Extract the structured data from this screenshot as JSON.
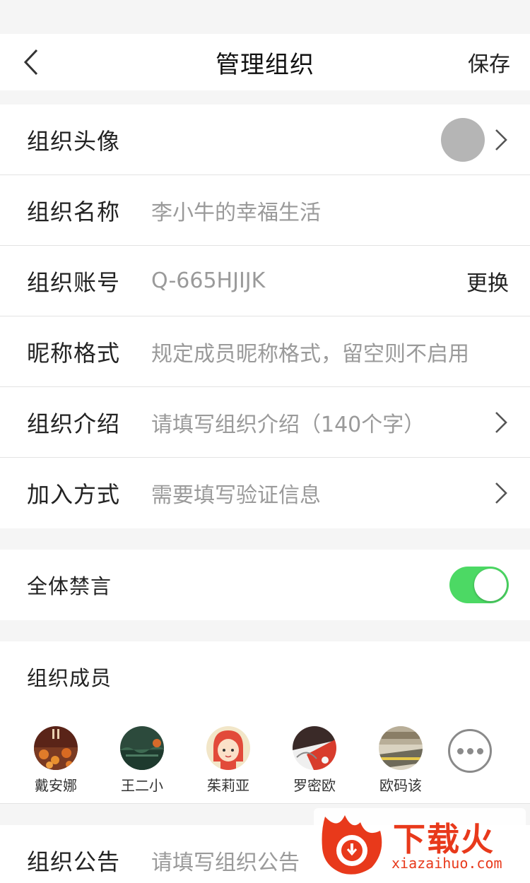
{
  "nav": {
    "title": "管理组织",
    "save_label": "保存"
  },
  "org_info": {
    "avatar_label": "组织头像",
    "name_label": "组织名称",
    "name_value": "李小牛的幸福生活",
    "account_label": "组织账号",
    "account_value": "Q-665HJIJK",
    "account_action": "更换",
    "nickname_label": "昵称格式",
    "nickname_placeholder": "规定成员昵称格式，留空则不启用",
    "intro_label": "组织介绍",
    "intro_placeholder": "请填写组织介绍（140个字）",
    "join_label": "加入方式",
    "join_value": "需要填写验证信息"
  },
  "mute": {
    "label": "全体禁言",
    "enabled": true
  },
  "members": {
    "label": "组织成员",
    "list": [
      {
        "name": "戴安娜"
      },
      {
        "name": "王二小"
      },
      {
        "name": "茱莉亚"
      },
      {
        "name": "罗密欧"
      },
      {
        "name": "欧码该"
      }
    ]
  },
  "notice": {
    "label": "组织公告",
    "placeholder": "请填写组织公告"
  },
  "watermark": {
    "brand": "下载火",
    "domain": "xiazaihuo.com"
  },
  "colors": {
    "toggle_on": "#4cd964",
    "placeholder": "#9a9a9a",
    "watermark": "#e8391b"
  }
}
